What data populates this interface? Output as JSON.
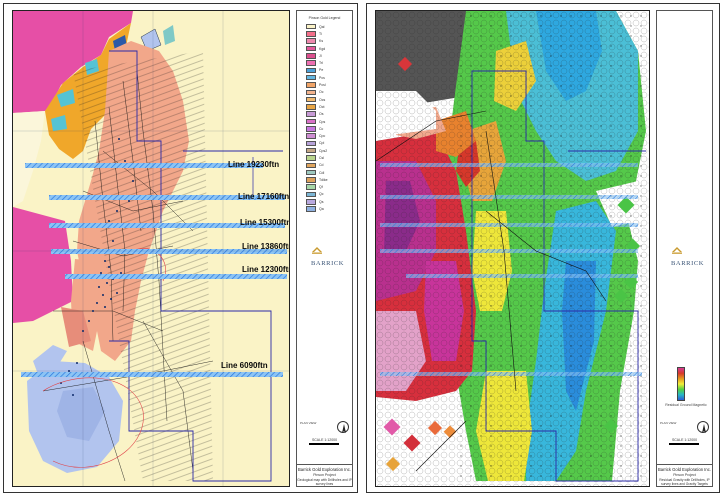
{
  "left_sheet": {
    "section_lines": [
      {
        "label": "Line 19230ftn"
      },
      {
        "label": "Line 17160ftn"
      },
      {
        "label": "Line 15300ftn"
      },
      {
        "label": "Line 13860ftn"
      },
      {
        "label": "Line 12300ftn"
      },
      {
        "label": "Line 6090ftn"
      }
    ],
    "legend": {
      "title": "Pinson Gold Legend",
      "items": [
        {
          "label": "Qal",
          "color": "#fbf3c8"
        },
        {
          "label": "Ti",
          "color": "#f36f8a"
        },
        {
          "label": "Ks",
          "color": "#ee88ad"
        },
        {
          "label": "Kgd",
          "color": "#e4589b"
        },
        {
          "label": "Jl",
          "color": "#db4f8e"
        },
        {
          "label": "Trl",
          "color": "#ee6fb1"
        },
        {
          "label": "Pe",
          "color": "#4ca0d8"
        },
        {
          "label": "Pcs",
          "color": "#63b6e0"
        },
        {
          "label": "Pcsl",
          "color": "#f0a468"
        },
        {
          "label": "Oc",
          "color": "#f3b38d"
        },
        {
          "label": "Ocs",
          "color": "#f1ba70"
        },
        {
          "label": "Oct",
          "color": "#e8a544"
        },
        {
          "label": "Os",
          "color": "#c79bd6"
        },
        {
          "label": "Cps",
          "color": "#d871c7"
        },
        {
          "label": "Cc",
          "color": "#c777df"
        },
        {
          "label": "Cpc",
          "color": "#ce8ed2"
        },
        {
          "label": "Cpl",
          "color": "#b7a3da"
        },
        {
          "label": "Cps2",
          "color": "#c4a886"
        },
        {
          "label": "Csl",
          "color": "#b9d58d"
        },
        {
          "label": "Cd",
          "color": "#e0a55f"
        },
        {
          "label": "Cdl",
          "color": "#9ec9c0"
        },
        {
          "label": "Tdike",
          "color": "#dca25c"
        },
        {
          "label": "Qf",
          "color": "#a6d6a7"
        },
        {
          "label": "Qc",
          "color": "#7cb6d5"
        },
        {
          "label": "Qs",
          "color": "#b9a9df"
        },
        {
          "label": "Qa",
          "color": "#8fb1e0"
        }
      ]
    },
    "logo_text": "BARRICK",
    "info_text": "PLAN VIEW",
    "scale_text": "SCALE 1:12000",
    "company": "Barrick Gold Exploration Inc.",
    "project": "Pinson Project",
    "map_title": "Geological map with Drillholes and IP survey lines"
  },
  "right_sheet": {
    "logo_text": "BARRICK",
    "colorbar_caption": "Residual Ground Magnetic",
    "info_text": "PLAN VIEW",
    "scale_text": "SCALE 1:12000",
    "company": "Barrick Gold Exploration Inc.",
    "project": "Pinson Project",
    "map_title": "Residual Gravity with Drillholes, IP survey lines and Gravity Targets"
  },
  "colors": {
    "background_yellow": "#faf3c6",
    "pink_unit": "#e64fa6",
    "orange_unit": "#f0a72a",
    "salmon_unit": "#f2a78a",
    "blue_unit": "#b2c4ee",
    "survey_line": "#3b8ee8",
    "claim_boundary": "#2a2aa8",
    "logo_gold": "#c99a2e",
    "logo_blue": "#3a5476"
  }
}
